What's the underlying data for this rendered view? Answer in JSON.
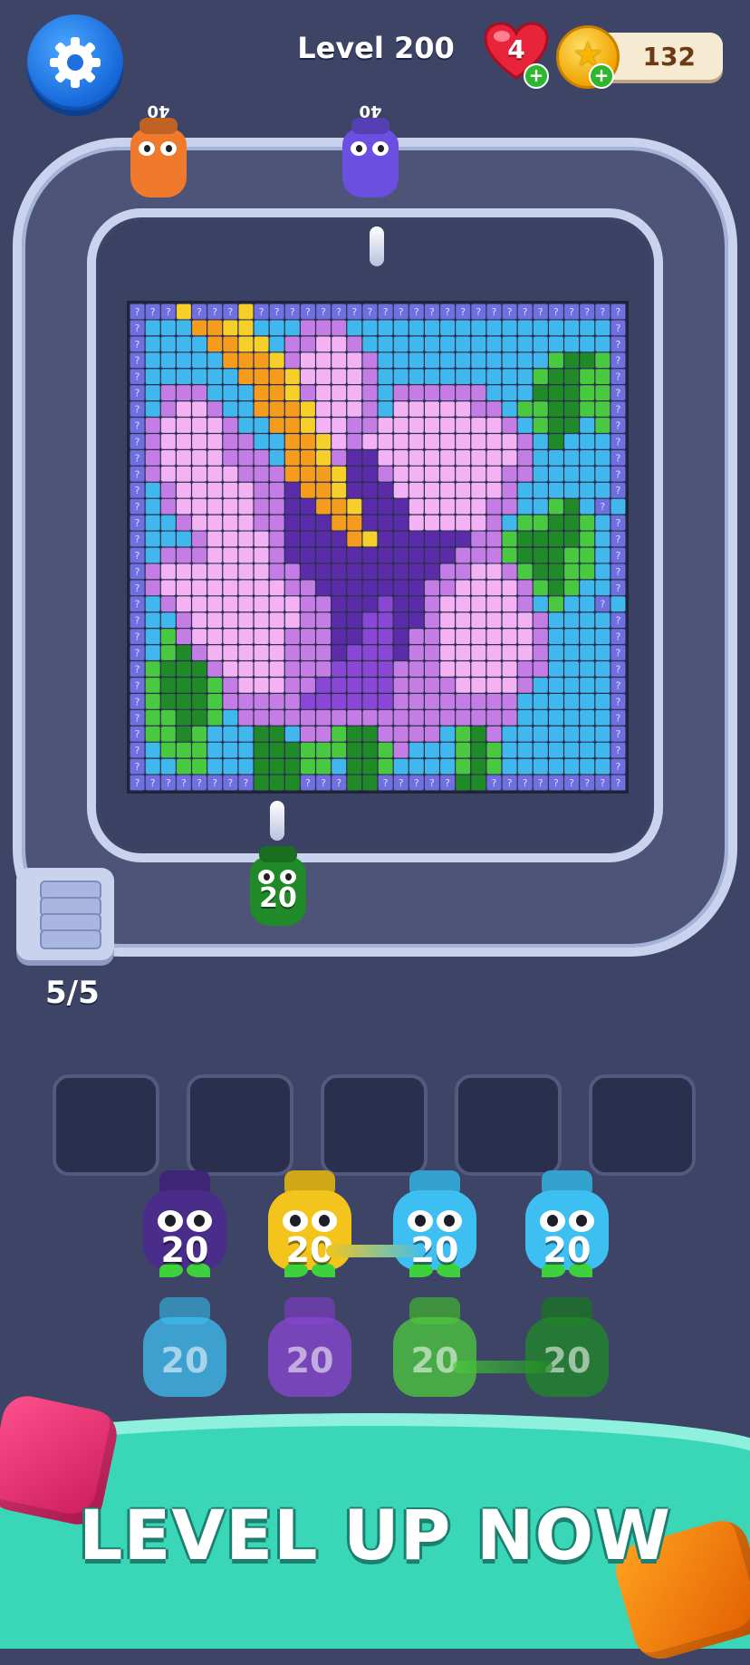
{
  "hud": {
    "level_label": "Level 200",
    "lives": "4",
    "coins": "132",
    "settings_icon": "gear-icon",
    "heart_icon": "heart-icon",
    "coin_icon": "star-coin-icon"
  },
  "track": {
    "shooters_top": [
      {
        "color": "#f07a2c",
        "number": "40"
      },
      {
        "color": "#6a4fe0",
        "number": "40"
      }
    ],
    "active_shooter": {
      "color": "#1f8a27",
      "number": "20"
    },
    "capacity": "5/5"
  },
  "board": {
    "palette": {
      "q": "#6f6fe0",
      "s": "#40b8ee",
      "y": "#f7cf2a",
      "o": "#f59c1e",
      "L": "#f3b2f3",
      "M": "#c57de6",
      "P": "#8a47d6",
      "D": "#5a2ca8",
      "g": "#48c940",
      "G": "#1f8a27"
    },
    "rows": [
      "qqqyqqqyqqqqqqqqqqqqqqqqqqqqqqqq",
      "qsssooyysssMMMsssssssssssssssssq",
      "qssssooyysMMLLMssssssssssssssssq",
      "qsssssoooyMLLLLMsssssssssssgGGgq",
      "qssssssoooyLLLLMssssssssssgGGggq",
      "qsMMMsssooyMLLLMsMMMMMMsssGGGggq",
      "qsMLLMssoooyLLLMsLLLLLMMsggGGggq",
      "qMLLLLMssooyLLMMLLLLLLLLMsgGGsgq",
      "qMLLLLMMssooyLMLLLLLLLLLLMsGsssq",
      "qMLLLLMMMsooyMDDLLLLLLLLLMsssssq",
      "qMLLLLLMMMoooyDDMLLLLLLLMMsssssq",
      "qsMLLLLLMMDooyDDDLLLLLLLMssssssq",
      "qsMLLLLLMMDDooyDDDLLLLLMMssgGsq",
      "qssMLLLLMMDDDooDDDLLLLLMsggGGgsq",
      "qsssMLLLLMDDDDoyDDDDDDMMgGGGGgsq",
      "qsMMMLLLLMDDDDDDDDDDDMMMgGGGggsq",
      "qMLLLLLLLMMDDDDDDDDDMMLLMgGGggsq",
      "qMLLLLLLLLMMDDDDDDDMMLLLLMgGgssq",
      "qsMLLLLLLLLMMDDDPDDMLLLLLMsgssq",
      "qssMLLLLLLLMMDDPPDDMLLLLLLMssssq",
      "qsgMLLLLLLMMMDDPPDMMLLLLLLMssssq",
      "qsgGMLLLLLMMMDPPPDMMLLLLLLMssssq",
      "qgGGGMLLLLMMMPPPPMMMLLLLLMMssssq",
      "qgGGGgMLLLMMPPPPPMMMMLLLLMsssssq",
      "qgGGGgMMMMMPPPPPPMMMMMMMMssssssq",
      "qggGGgsMMMMMMMMMMMMMMMMMMssssssq",
      "qggGgsssGGsMMgGGMMMMsgGMsssssssq",
      "qsgggsssGGGgggGGgMsssgGgsssssssq",
      "qssggsssGGGggsGGgssssgGgsssssssq",
      "qqqqqqqqGGGqqqGGqqqqqGGqqqqqqqqq"
    ]
  },
  "slots": 5,
  "tray": [
    {
      "color": "#4a2c8a",
      "number": "20",
      "state": "active"
    },
    {
      "color": "#f3c51c",
      "number": "20",
      "state": "active"
    },
    {
      "color": "#3dbff2",
      "number": "20",
      "state": "active"
    },
    {
      "color": "#3dbff2",
      "number": "20",
      "state": "active"
    },
    {
      "color": "#3dbff2",
      "number": "20",
      "state": "locked"
    },
    {
      "color": "#8a47d6",
      "number": "20",
      "state": "locked"
    },
    {
      "color": "#4ccb3d",
      "number": "20",
      "state": "locked"
    },
    {
      "color": "#1f8a27",
      "number": "20",
      "state": "locked"
    }
  ],
  "cta": {
    "label": "LEVEL UP NOW"
  }
}
